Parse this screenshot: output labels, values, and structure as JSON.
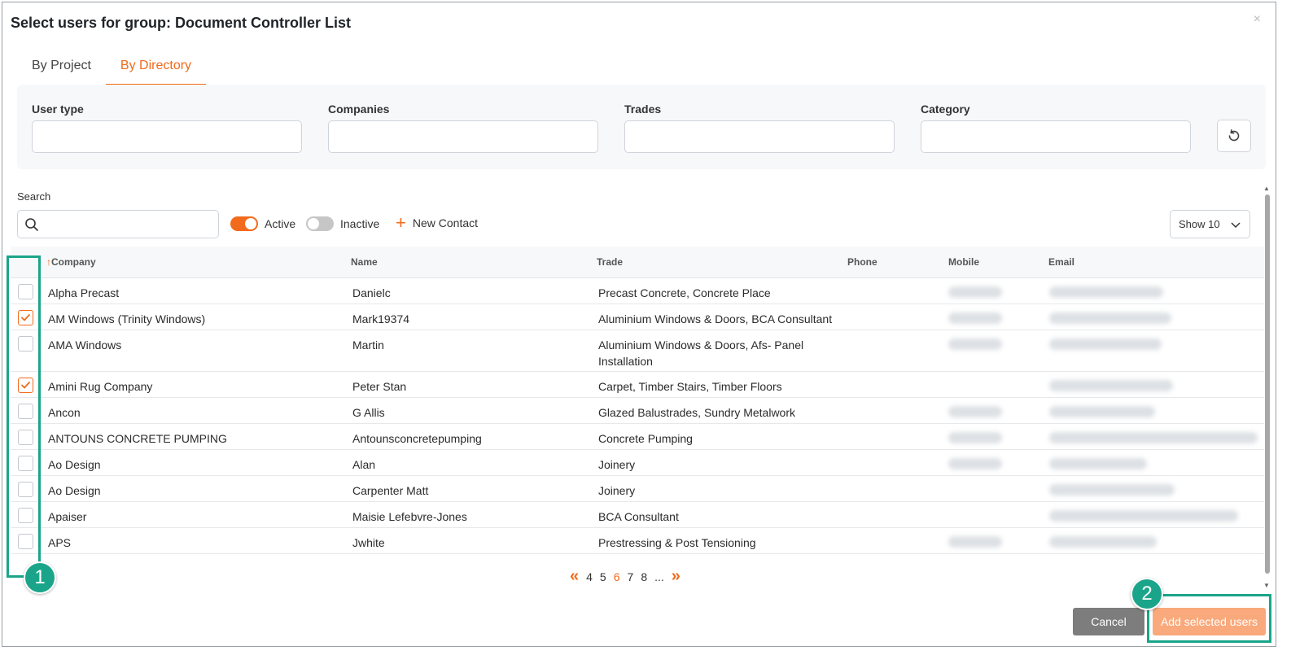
{
  "modal": {
    "title": "Select users for group: Document Controller List",
    "close": "×"
  },
  "tabs": [
    {
      "label": "By Project",
      "active": false
    },
    {
      "label": "By Directory",
      "active": true
    }
  ],
  "filters": {
    "user_type": "User type",
    "companies": "Companies",
    "trades": "Trades",
    "category": "Category"
  },
  "search": {
    "label": "Search",
    "placeholder": "",
    "value": ""
  },
  "toggles": {
    "active_label": "Active",
    "inactive_label": "Inactive"
  },
  "new_contact_label": "New Contact",
  "show_select": {
    "value": "Show 10"
  },
  "table": {
    "headers": {
      "sort_arrow": "↑",
      "company": "Company",
      "name": "Name",
      "trade": "Trade",
      "phone": "Phone",
      "mobile": "Mobile",
      "email": "Email"
    },
    "rows": [
      {
        "company": "Alpha Precast",
        "name": "Danielc",
        "trade": "Precast Concrete, Concrete Place",
        "checked": false
      },
      {
        "company": "AM Windows (Trinity Windows)",
        "name": "Mark19374",
        "trade": "Aluminium Windows & Doors, BCA Consultant",
        "checked": true
      },
      {
        "company": "AMA Windows",
        "name": "Martin",
        "trade": "Aluminium Windows & Doors, Afs- Panel Installation",
        "checked": false
      },
      {
        "company": "Amini Rug Company",
        "name": "Peter Stan",
        "trade": "Carpet, Timber Stairs, Timber Floors",
        "checked": true
      },
      {
        "company": "Ancon",
        "name": "G Allis",
        "trade": "Glazed Balustrades, Sundry Metalwork",
        "checked": false
      },
      {
        "company": "ANTOUNS CONCRETE PUMPING",
        "name": "Antounsconcretepumping",
        "trade": "Concrete Pumping",
        "checked": false
      },
      {
        "company": "Ao Design",
        "name": "Alan",
        "trade": "Joinery",
        "checked": false
      },
      {
        "company": "Ao Design",
        "name": "Carpenter Matt",
        "trade": "Joinery",
        "checked": false
      },
      {
        "company": "Apaiser",
        "name": "Maisie Lefebvre-Jones",
        "trade": "BCA Consultant",
        "checked": false
      },
      {
        "company": "APS",
        "name": "Jwhite",
        "trade": "Prestressing & Post Tensioning",
        "checked": false
      }
    ]
  },
  "pagination": {
    "prev": "«",
    "pages": [
      "4",
      "5",
      "6",
      "7",
      "8"
    ],
    "current": "6",
    "ellipsis": "...",
    "next": "»"
  },
  "buttons": {
    "cancel": "Cancel",
    "add_selected": "Add selected users"
  },
  "annotations": {
    "badge_1": "1",
    "badge_2": "2"
  },
  "colors": {
    "accent": "#f26a1b",
    "highlight": "#1aa58a",
    "cancel_bg": "#7d7d7d",
    "add_bg": "#f9a97b"
  }
}
